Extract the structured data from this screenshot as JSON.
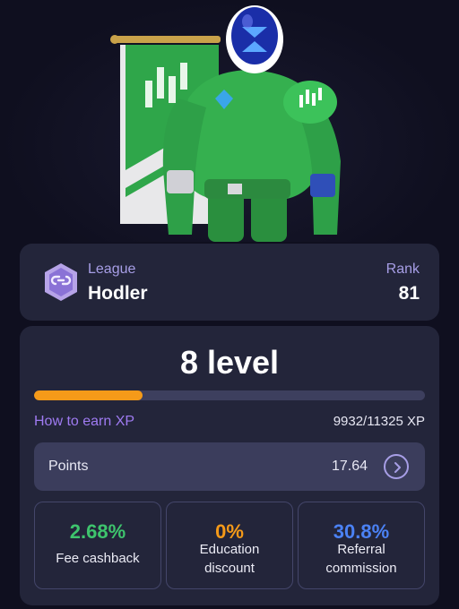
{
  "league": {
    "label": "League",
    "value": "Hodler",
    "rank_label": "Rank",
    "rank_value": "81",
    "badge_icon": "hexagon-link-badge-icon"
  },
  "level": {
    "title": "8 level",
    "progress_fraction": 0.277,
    "progress_color": "#f59a19",
    "earn_link": "How to earn XP",
    "xp_text": "9932/11325 XP"
  },
  "points": {
    "label": "Points",
    "value": "17.64",
    "arrow_icon": "chevron-right-circle-icon"
  },
  "stats": [
    {
      "value": "2.68%",
      "label_line1": "Fee cashback",
      "label_line2": "",
      "color": "#3ec46d"
    },
    {
      "value": "0%",
      "label_line1": "Education",
      "label_line2": "discount",
      "color": "#f59a19"
    },
    {
      "value": "30.8%",
      "label_line1": "Referral",
      "label_line2": "commission",
      "color": "#4b82f5"
    }
  ],
  "colors": {
    "accent_purple": "#9f7bf2",
    "card_bg": "#23253a",
    "page_bg": "#0f0f1f"
  }
}
